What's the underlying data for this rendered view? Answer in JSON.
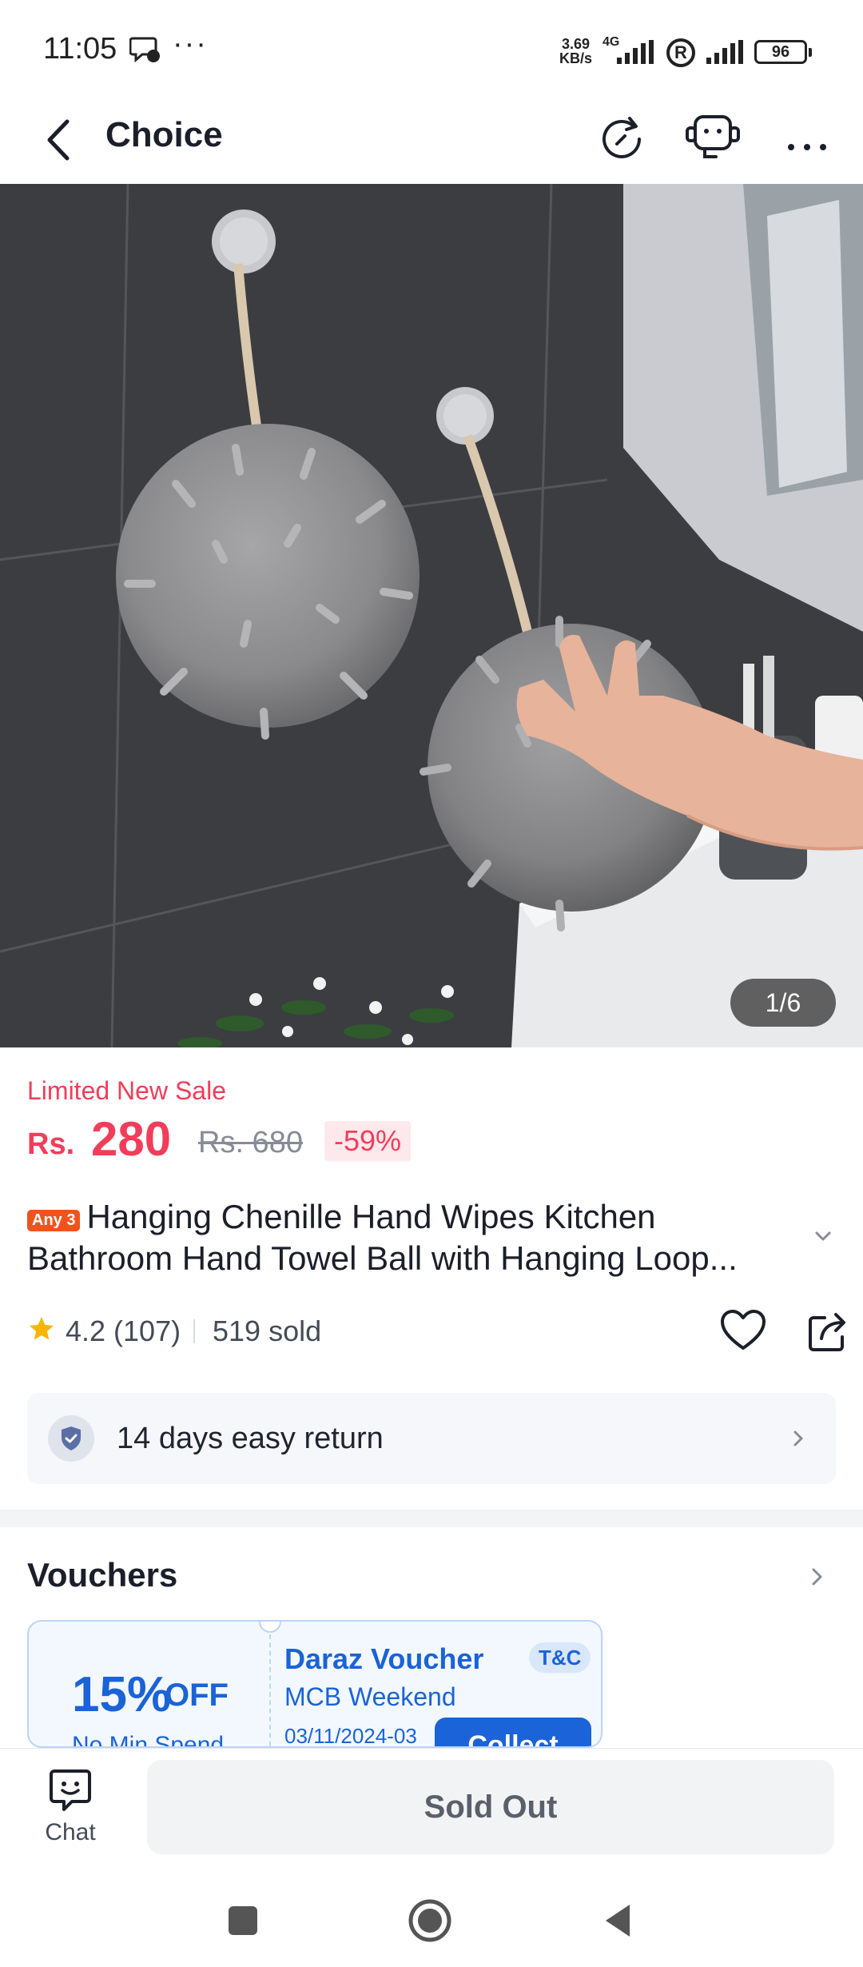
{
  "status_bar": {
    "time": "11:05",
    "speed_value": "3.69",
    "speed_unit": "KB/s",
    "network": "4G",
    "battery": "96"
  },
  "header": {
    "title": "Choice"
  },
  "gallery": {
    "counter": "1/6"
  },
  "pricing": {
    "sale_label": "Limited New Sale",
    "currency": "Rs.",
    "price": "280",
    "original_price": "Rs. 680",
    "discount": "-59%"
  },
  "product": {
    "badge": "Any 3",
    "title": "Hanging Chenille Hand Wipes Kitchen Bathroom Hand Towel Ball with Hanging Loop..."
  },
  "rating": {
    "score_reviews": "4.2 (107)",
    "sold": "519 sold"
  },
  "return_policy": {
    "text": "14 days easy return"
  },
  "vouchers": {
    "title": "Vouchers",
    "items": [
      {
        "percent": "15%",
        "off": "OFF",
        "condition": "No Min Spend",
        "name": "Daraz Voucher",
        "terms": "T&C",
        "subtitle": "MCB Weekend",
        "date": "03/11/2024-03",
        "action": "Collect"
      }
    ]
  },
  "bottom_bar": {
    "chat_label": "Chat",
    "sold_out_label": "Sold Out"
  },
  "colors": {
    "accent": "#f23d5a",
    "voucher_blue": "#1a63d8"
  }
}
